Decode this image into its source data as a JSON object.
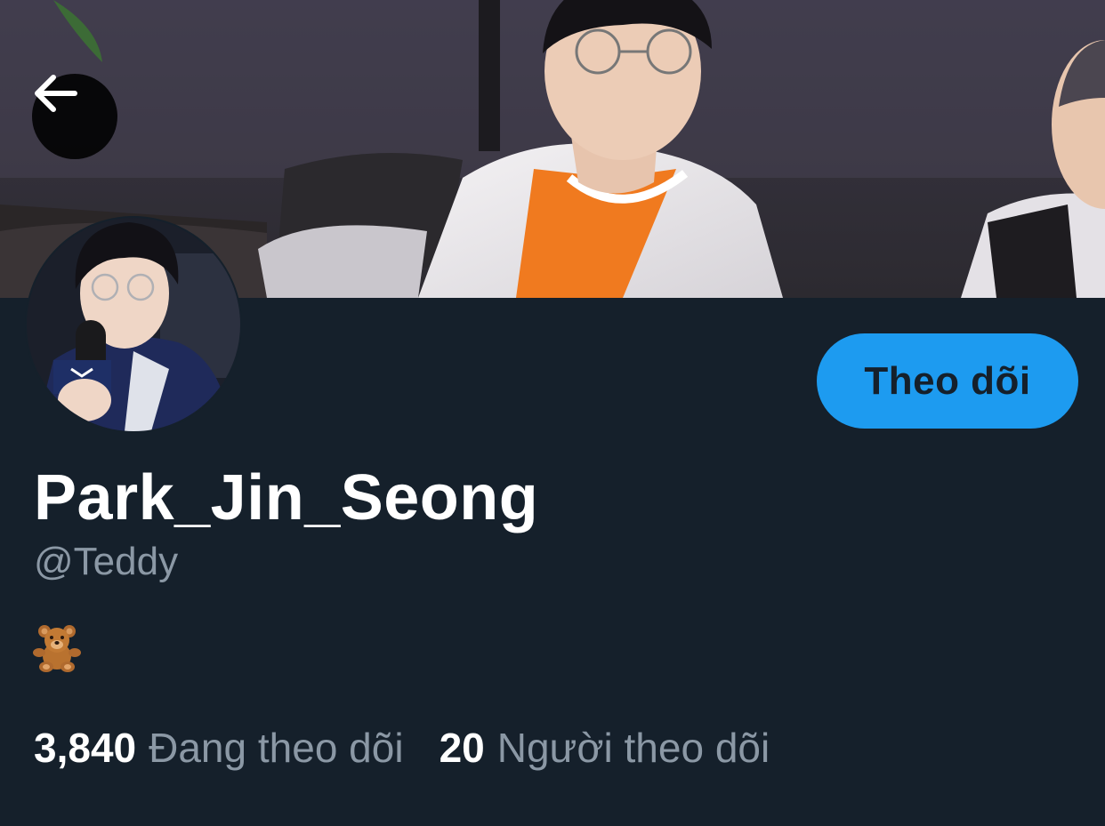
{
  "header": {
    "back_icon": "arrow-left-icon",
    "banner_image": "profile-banner-photo"
  },
  "profile": {
    "avatar_image": "profile-avatar-photo",
    "display_name": "Park_Jin_Seong",
    "handle": "@Teddy",
    "bio_emoji": "teddy-bear-emoji",
    "follow_label": "Theo dõi"
  },
  "stats": {
    "following_count": "3,840",
    "following_label": "Đang theo dõi",
    "followers_count": "20",
    "followers_label": "Người theo dõi"
  },
  "colors": {
    "background": "#15202b",
    "accent": "#1d9bf0",
    "secondary_text": "#8b98a5",
    "primary_text": "#ffffff"
  }
}
